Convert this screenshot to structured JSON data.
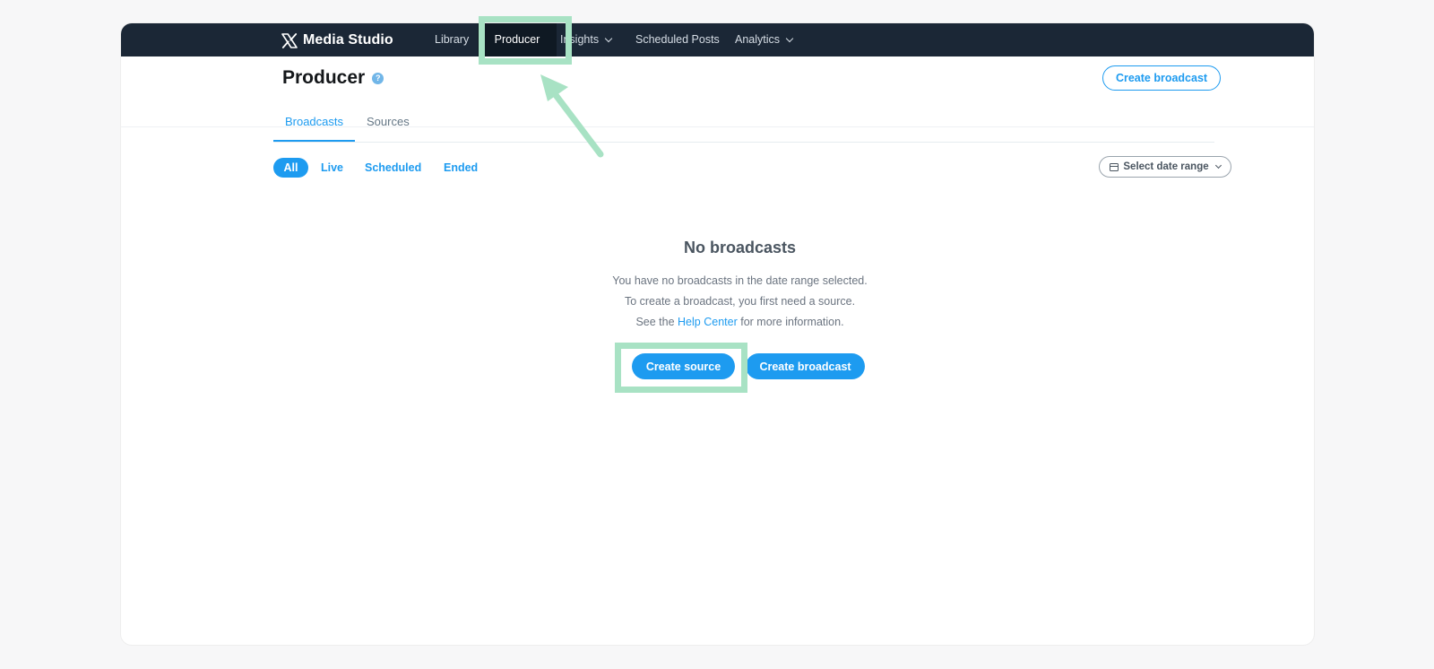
{
  "app": {
    "logo_icon": "x-logo-icon",
    "name": "Media Studio"
  },
  "nav": {
    "library": "Library",
    "producer": "Producer",
    "insights": "Insights",
    "scheduled_posts": "Scheduled Posts",
    "analytics": "Analytics"
  },
  "page": {
    "title": "Producer",
    "help_icon": "?",
    "create_broadcast_label": "Create broadcast"
  },
  "tabs": {
    "broadcasts": "Broadcasts",
    "sources": "Sources"
  },
  "filters": {
    "all": "All",
    "live": "Live",
    "scheduled": "Scheduled",
    "ended": "Ended"
  },
  "date_range": {
    "icon": "calendar-icon",
    "label": "Select date range"
  },
  "empty_state": {
    "title": "No broadcasts",
    "line1": "You have no broadcasts in the date range selected.",
    "line2": "To create a broadcast, you first need a source.",
    "line3_prefix": "See the",
    "line3_link": "Help Center",
    "line3_suffix": "for more information.",
    "create_source_label": "Create source",
    "create_broadcast_label": "Create broadcast"
  },
  "colors": {
    "topbar": "#1b2736",
    "accent": "#1d9bf0",
    "highlight": "#a8e2c4"
  }
}
